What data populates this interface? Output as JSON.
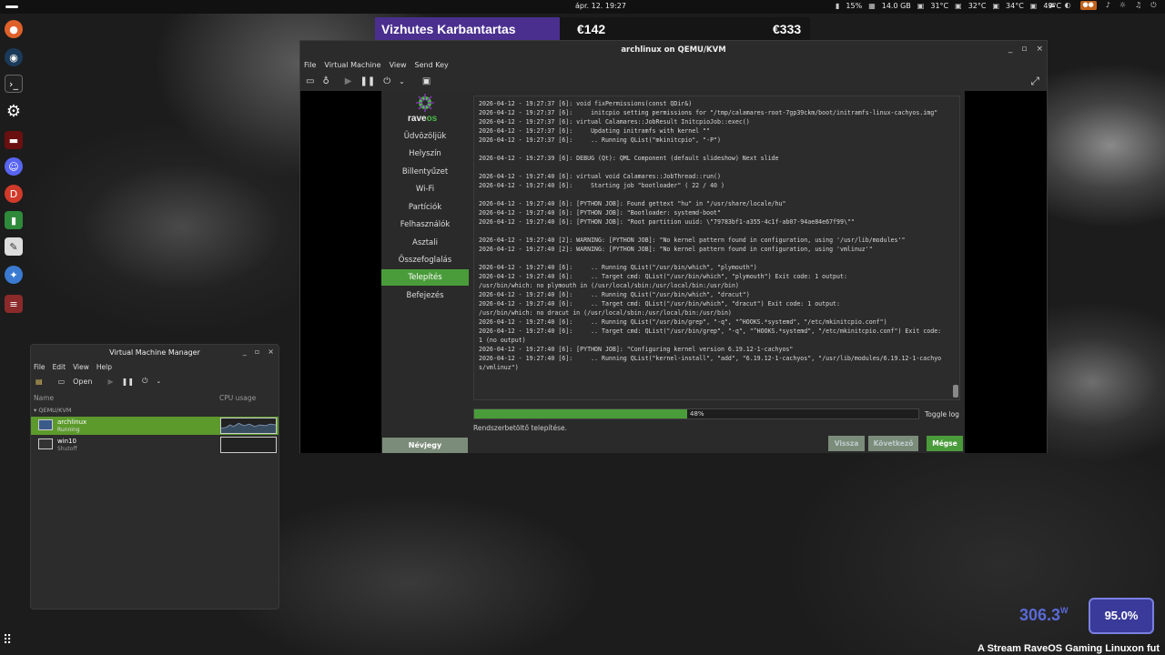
{
  "topbar": {
    "clock": "ápr. 12.  19:27",
    "battery": "15%",
    "memory": "14.0 GB",
    "temp1": "31°C",
    "temp2": "32°C",
    "temp3": "34°C",
    "temp4": "49°C"
  },
  "overlay": {
    "title": "Vizhutes Karbantartas",
    "price1": "€142",
    "price2": "€333"
  },
  "qemu": {
    "title": "archlinux on QEMU/KVM",
    "menu": [
      "File",
      "Virtual Machine",
      "View",
      "Send Key"
    ]
  },
  "calamares": {
    "brand_a": "rave",
    "brand_b": "os",
    "steps": [
      "Üdvözöljük",
      "Helyszín",
      "Billentyűzet",
      "Wi-Fi",
      "Partíciók",
      "Felhasználók",
      "Asztali",
      "Összefoglalás",
      "Telepítés",
      "Befejezés"
    ],
    "active_step": "Telepítés",
    "about": "Névjegy",
    "log": "2026-04-12 - 19:27:37 [6]: void fixPermissions(const QDir&)\n2026-04-12 - 19:27:37 [6]:     initcpio setting permissions for \"/tmp/calamares-root-7gp39ckm/boot/initramfs-linux-cachyos.img\"\n2026-04-12 - 19:27:37 [6]: virtual Calamares::JobResult InitcpioJob::exec()\n2026-04-12 - 19:27:37 [6]:     Updating initramfs with kernel \"\"\n2026-04-12 - 19:27:37 [6]:     .. Running QList(\"mkinitcpio\", \"-P\")\n\n2026-04-12 - 19:27:39 [6]: DEBUG (Qt): QML Component (default slideshow) Next slide\n\n2026-04-12 - 19:27:40 [6]: virtual void Calamares::JobThread::run()\n2026-04-12 - 19:27:40 [6]:     Starting job \"bootloader\" ( 22 / 40 )\n\n2026-04-12 - 19:27:40 [6]: [PYTHON JOB]: Found gettext \"hu\" in \"/usr/share/locale/hu\"\n2026-04-12 - 19:27:40 [6]: [PYTHON JOB]: \"Bootloader: systemd-boot\"\n2026-04-12 - 19:27:40 [6]: [PYTHON JOB]: \"Root partition uuid: \\\"79783bf1-a355-4c1f-ab07-94ae84e67f99\\\"\"\n\n2026-04-12 - 19:27:40 [2]: WARNING: [PYTHON JOB]: \"No kernel pattern found in configuration, using '/usr/lib/modules'\"\n2026-04-12 - 19:27:40 [2]: WARNING: [PYTHON JOB]: \"No kernel pattern found in configuration, using 'vmlinuz'\"\n\n2026-04-12 - 19:27:40 [6]:     .. Running QList(\"/usr/bin/which\", \"plymouth\")\n2026-04-12 - 19:27:40 [6]:     .. Target cmd: QList(\"/usr/bin/which\", \"plymouth\") Exit code: 1 output:\n/usr/bin/which: no plymouth in (/usr/local/sbin:/usr/local/bin:/usr/bin)\n2026-04-12 - 19:27:40 [6]:     .. Running QList(\"/usr/bin/which\", \"dracut\")\n2026-04-12 - 19:27:40 [6]:     .. Target cmd: QList(\"/usr/bin/which\", \"dracut\") Exit code: 1 output:\n/usr/bin/which: no dracut in (/usr/local/sbin:/usr/local/bin:/usr/bin)\n2026-04-12 - 19:27:40 [6]:     .. Running QList(\"/usr/bin/grep\", \"-q\", \"^HOOKS.*systemd\", \"/etc/mkinitcpio.conf\")\n2026-04-12 - 19:27:40 [6]:     .. Target cmd: QList(\"/usr/bin/grep\", \"-q\", \"^HOOKS.*systemd\", \"/etc/mkinitcpio.conf\") Exit code: 1 (no output)\n2026-04-12 - 19:27:40 [6]: [PYTHON JOB]: \"Configuring kernel version 6.19.12-1-cachyos\"\n2026-04-12 - 19:27:40 [6]:     .. Running QList(\"kernel-install\", \"add\", \"6.19.12-1-cachyos\", \"/usr/lib/modules/6.19.12-1-cachyos/vmlinuz\")",
    "progress_percent": 48,
    "progress_label": "48%",
    "toggle_log": "Toggle log",
    "status": "Rendszerbetöltő telepítése.",
    "back": "Vissza",
    "next": "Következő",
    "cancel": "Mégse"
  },
  "vmm": {
    "title": "Virtual Machine Manager",
    "menu": [
      "File",
      "Edit",
      "View",
      "Help"
    ],
    "open": "Open",
    "col_name": "Name",
    "col_cpu": "CPU usage",
    "group": "QEMU/KVM",
    "vms": [
      {
        "name": "archlinux",
        "state": "Running"
      },
      {
        "name": "win10",
        "state": "Shutoff"
      }
    ]
  },
  "hud": {
    "watts": "306.3",
    "watts_unit": "W",
    "cpu": "95.0%",
    "ticker": "A Stream RaveOS Gaming Linuxon fut"
  },
  "colors": {
    "accent_green": "#4a9c3a",
    "overlay_purple": "#4a2f8f",
    "hud_blue": "#3a3a9a"
  }
}
